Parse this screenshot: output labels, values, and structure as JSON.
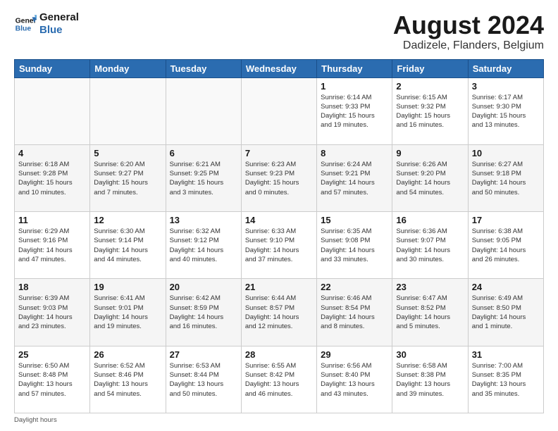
{
  "logo": {
    "line1": "General",
    "line2": "Blue"
  },
  "title": "August 2024",
  "subtitle": "Dadizele, Flanders, Belgium",
  "weekdays": [
    "Sunday",
    "Monday",
    "Tuesday",
    "Wednesday",
    "Thursday",
    "Friday",
    "Saturday"
  ],
  "weeks": [
    [
      {
        "day": "",
        "info": ""
      },
      {
        "day": "",
        "info": ""
      },
      {
        "day": "",
        "info": ""
      },
      {
        "day": "",
        "info": ""
      },
      {
        "day": "1",
        "info": "Sunrise: 6:14 AM\nSunset: 9:33 PM\nDaylight: 15 hours\nand 19 minutes."
      },
      {
        "day": "2",
        "info": "Sunrise: 6:15 AM\nSunset: 9:32 PM\nDaylight: 15 hours\nand 16 minutes."
      },
      {
        "day": "3",
        "info": "Sunrise: 6:17 AM\nSunset: 9:30 PM\nDaylight: 15 hours\nand 13 minutes."
      }
    ],
    [
      {
        "day": "4",
        "info": "Sunrise: 6:18 AM\nSunset: 9:28 PM\nDaylight: 15 hours\nand 10 minutes."
      },
      {
        "day": "5",
        "info": "Sunrise: 6:20 AM\nSunset: 9:27 PM\nDaylight: 15 hours\nand 7 minutes."
      },
      {
        "day": "6",
        "info": "Sunrise: 6:21 AM\nSunset: 9:25 PM\nDaylight: 15 hours\nand 3 minutes."
      },
      {
        "day": "7",
        "info": "Sunrise: 6:23 AM\nSunset: 9:23 PM\nDaylight: 15 hours\nand 0 minutes."
      },
      {
        "day": "8",
        "info": "Sunrise: 6:24 AM\nSunset: 9:21 PM\nDaylight: 14 hours\nand 57 minutes."
      },
      {
        "day": "9",
        "info": "Sunrise: 6:26 AM\nSunset: 9:20 PM\nDaylight: 14 hours\nand 54 minutes."
      },
      {
        "day": "10",
        "info": "Sunrise: 6:27 AM\nSunset: 9:18 PM\nDaylight: 14 hours\nand 50 minutes."
      }
    ],
    [
      {
        "day": "11",
        "info": "Sunrise: 6:29 AM\nSunset: 9:16 PM\nDaylight: 14 hours\nand 47 minutes."
      },
      {
        "day": "12",
        "info": "Sunrise: 6:30 AM\nSunset: 9:14 PM\nDaylight: 14 hours\nand 44 minutes."
      },
      {
        "day": "13",
        "info": "Sunrise: 6:32 AM\nSunset: 9:12 PM\nDaylight: 14 hours\nand 40 minutes."
      },
      {
        "day": "14",
        "info": "Sunrise: 6:33 AM\nSunset: 9:10 PM\nDaylight: 14 hours\nand 37 minutes."
      },
      {
        "day": "15",
        "info": "Sunrise: 6:35 AM\nSunset: 9:08 PM\nDaylight: 14 hours\nand 33 minutes."
      },
      {
        "day": "16",
        "info": "Sunrise: 6:36 AM\nSunset: 9:07 PM\nDaylight: 14 hours\nand 30 minutes."
      },
      {
        "day": "17",
        "info": "Sunrise: 6:38 AM\nSunset: 9:05 PM\nDaylight: 14 hours\nand 26 minutes."
      }
    ],
    [
      {
        "day": "18",
        "info": "Sunrise: 6:39 AM\nSunset: 9:03 PM\nDaylight: 14 hours\nand 23 minutes."
      },
      {
        "day": "19",
        "info": "Sunrise: 6:41 AM\nSunset: 9:01 PM\nDaylight: 14 hours\nand 19 minutes."
      },
      {
        "day": "20",
        "info": "Sunrise: 6:42 AM\nSunset: 8:59 PM\nDaylight: 14 hours\nand 16 minutes."
      },
      {
        "day": "21",
        "info": "Sunrise: 6:44 AM\nSunset: 8:57 PM\nDaylight: 14 hours\nand 12 minutes."
      },
      {
        "day": "22",
        "info": "Sunrise: 6:46 AM\nSunset: 8:54 PM\nDaylight: 14 hours\nand 8 minutes."
      },
      {
        "day": "23",
        "info": "Sunrise: 6:47 AM\nSunset: 8:52 PM\nDaylight: 14 hours\nand 5 minutes."
      },
      {
        "day": "24",
        "info": "Sunrise: 6:49 AM\nSunset: 8:50 PM\nDaylight: 14 hours\nand 1 minute."
      }
    ],
    [
      {
        "day": "25",
        "info": "Sunrise: 6:50 AM\nSunset: 8:48 PM\nDaylight: 13 hours\nand 57 minutes."
      },
      {
        "day": "26",
        "info": "Sunrise: 6:52 AM\nSunset: 8:46 PM\nDaylight: 13 hours\nand 54 minutes."
      },
      {
        "day": "27",
        "info": "Sunrise: 6:53 AM\nSunset: 8:44 PM\nDaylight: 13 hours\nand 50 minutes."
      },
      {
        "day": "28",
        "info": "Sunrise: 6:55 AM\nSunset: 8:42 PM\nDaylight: 13 hours\nand 46 minutes."
      },
      {
        "day": "29",
        "info": "Sunrise: 6:56 AM\nSunset: 8:40 PM\nDaylight: 13 hours\nand 43 minutes."
      },
      {
        "day": "30",
        "info": "Sunrise: 6:58 AM\nSunset: 8:38 PM\nDaylight: 13 hours\nand 39 minutes."
      },
      {
        "day": "31",
        "info": "Sunrise: 7:00 AM\nSunset: 8:35 PM\nDaylight: 13 hours\nand 35 minutes."
      }
    ]
  ],
  "footer": "Daylight hours"
}
